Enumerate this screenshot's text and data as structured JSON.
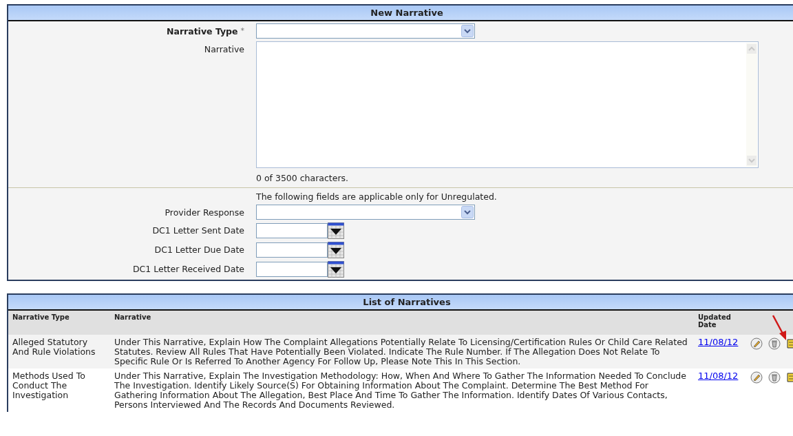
{
  "new_narrative": {
    "title": "New Narrative",
    "fields": [
      {
        "kind": "select",
        "label": "Narrative Type",
        "required_mark": "*"
      },
      {
        "kind": "textarea",
        "label": "Narrative",
        "counter": "0 of 3500 characters."
      }
    ],
    "note": "The following fields are applicable only for Unregulated.",
    "unregulated_fields": [
      {
        "kind": "select",
        "label": "Provider Response"
      },
      {
        "kind": "date",
        "label": "DC1 Letter Sent Date"
      },
      {
        "kind": "date",
        "label": "DC1 Letter Due Date"
      },
      {
        "kind": "date",
        "label": "DC1 Letter Received Date"
      }
    ]
  },
  "list_of_narratives": {
    "title": "List of Narratives",
    "columns": [
      "Narrative Type",
      "Narrative",
      "Updated Date"
    ],
    "rows": [
      {
        "narrative_type": "Alleged Statutory And Rule Violations",
        "narrative": "Under This Narrative, Explain How The Complaint Allegations Potentially Relate To Licensing/Certification Rules Or Child Care Related Statutes. Review All Rules That Have Potentially Been Violated. Indicate The Rule Number. If The Allegation Does Not Relate To Specific Rule Or Is Referred To Another Agency For Follow Up, Please Note This In This Section.",
        "updated_date": "11/08/12"
      },
      {
        "narrative_type": "Methods Used To Conduct The Investigation",
        "narrative": "Under This Narrative, Explain The Investigation Methodology: How, When And Where To Gather The Information Needed To Conclude The Investigation. Identify Likely Source(S) For Obtaining Information About The Complaint. Determine The Best Method For Gathering Information About The Allegation, Best Place And Time To Gather The Information. Identify Dates Of Various Contacts, Persons Interviewed And The Records And Documents Reviewed.",
        "updated_date": "11/08/12"
      }
    ]
  }
}
